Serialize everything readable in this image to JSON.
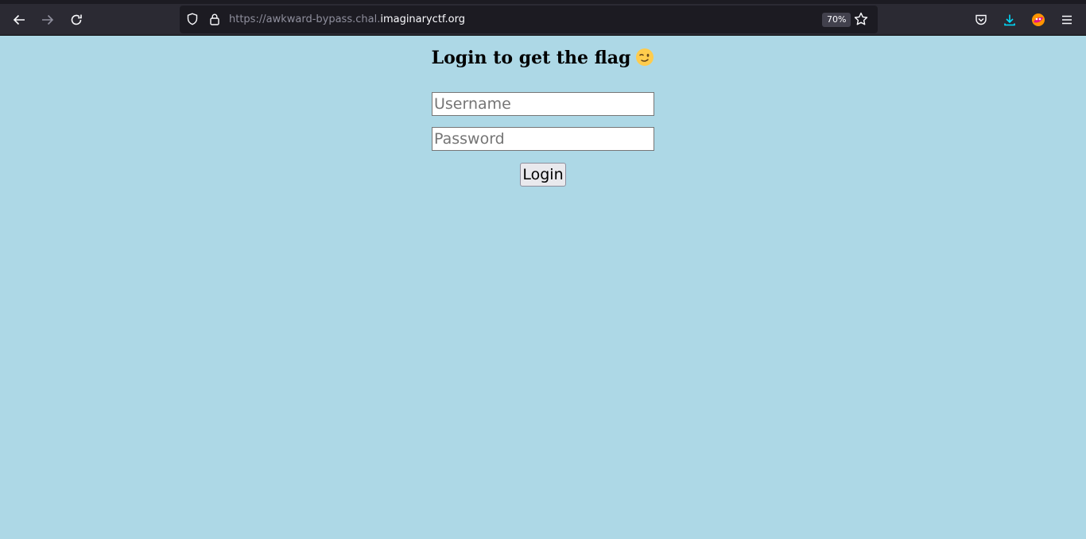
{
  "browser": {
    "url_prefix": "https://awkward-bypass.chal.",
    "url_domain": "imaginaryctf.org",
    "zoom": "70%"
  },
  "icons": {
    "back": "arrow-left-icon",
    "forward": "arrow-right-icon",
    "reload": "reload-icon",
    "tracking": "shield-icon",
    "secure": "lock-icon",
    "bookmark": "star-icon",
    "pocket": "pocket-icon",
    "downloads": "download-icon",
    "extension": "fox-extension-icon",
    "menu": "hamburger-menu-icon",
    "title_emoji": "winking-face-icon"
  },
  "colors": {
    "page_background": "#add8e6",
    "chrome": "#2b2a33",
    "download_accent": "#00ddff"
  },
  "page": {
    "title": "Login to get the flag",
    "username_placeholder": "Username",
    "username_value": "",
    "password_placeholder": "Password",
    "password_value": "",
    "login_label": "Login"
  }
}
